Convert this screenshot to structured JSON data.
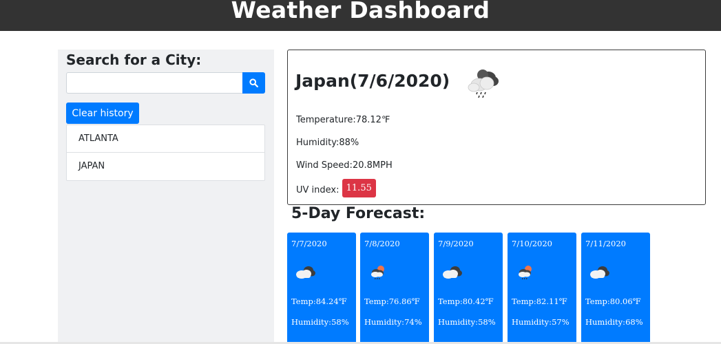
{
  "header": {
    "title": "Weather Dashboard"
  },
  "sidebar": {
    "heading": "Search for a City:",
    "search": {
      "value": "",
      "placeholder": ""
    },
    "search_icon": "search-icon",
    "clear_label": "Clear history",
    "history": [
      {
        "label": "ATLANTA"
      },
      {
        "label": "JAPAN"
      }
    ]
  },
  "current": {
    "title": "Japan(7/6/2020)",
    "icon": "rain-cloud-icon",
    "temperature_label": "Temperature:",
    "temperature": "78.12℉",
    "humidity_label": "Humidity:",
    "humidity": "88%",
    "wind_label": "Wind Speed:",
    "wind": "20.8MPH",
    "uv_label": "UV index:",
    "uv": "11.55",
    "uv_color": "#dc3545"
  },
  "forecast": {
    "title": "5-Day Forecast:",
    "temp_label": "Temp:",
    "humidity_label": "Humidity:",
    "days": [
      {
        "date": "7/7/2020",
        "icon": "cloud-icon",
        "temp": "84.24℉",
        "humidity": "58%"
      },
      {
        "date": "7/8/2020",
        "icon": "sun-rain-cloud-icon",
        "temp": "76.86℉",
        "humidity": "74%"
      },
      {
        "date": "7/9/2020",
        "icon": "cloud-icon",
        "temp": "80.42℉",
        "humidity": "58%"
      },
      {
        "date": "7/10/2020",
        "icon": "sun-rain-cloud-icon",
        "temp": "82.11℉",
        "humidity": "57%"
      },
      {
        "date": "7/11/2020",
        "icon": "cloud-icon",
        "temp": "80.06℉",
        "humidity": "68%"
      }
    ]
  },
  "colors": {
    "accent": "#007bff",
    "header": "#333333",
    "danger": "#dc3545"
  }
}
